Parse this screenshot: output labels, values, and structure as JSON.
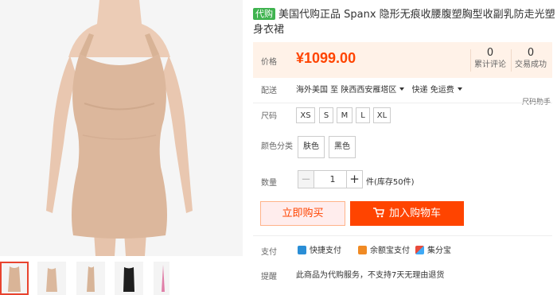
{
  "product": {
    "badge": "代购",
    "title": "美国代购正品 Spanx 隐形无痕收腰腹塑胸型收副乳防走光塑身衣裙"
  },
  "price": {
    "label": "价格",
    "value": "¥1099.00",
    "reviews_count": "0",
    "reviews_label": "累计评论",
    "sales_count": "0",
    "sales_label": "交易成功"
  },
  "shipping": {
    "label": "配送",
    "from": "海外美国 至",
    "to": "陕西西安雁塔区",
    "method": "快递 免运费"
  },
  "size": {
    "label": "尺码",
    "help": "尺码助手",
    "options": [
      "XS",
      "S",
      "M",
      "L",
      "XL"
    ]
  },
  "color": {
    "label": "颜色分类",
    "options": [
      "肤色",
      "黑色"
    ]
  },
  "quantity": {
    "label": "数量",
    "value": "1",
    "minus": "−",
    "plus": "+",
    "stock": "件(库存50件)"
  },
  "actions": {
    "buy_now": "立即购买",
    "add_to_cart": "加入购物车"
  },
  "payment": {
    "label": "支付",
    "methods": [
      "快捷支付",
      "余额宝支付",
      "集分宝"
    ]
  },
  "reminder": {
    "label": "提醒",
    "text": "此商品为代购服务，不支持7天无理由退货"
  },
  "colors": {
    "accent": "#ff4400",
    "price_bg": "#fff2e8",
    "badge": "#3fb34f"
  }
}
